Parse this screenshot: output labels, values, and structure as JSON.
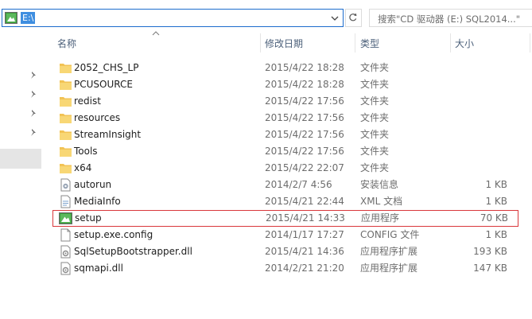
{
  "address_bar": {
    "path": "E:\\"
  },
  "search": {
    "placeholder": "搜索\"CD 驱动器 (E:) SQL2014...\""
  },
  "columns": {
    "name": "名称",
    "date": "修改日期",
    "type": "类型",
    "size": "大小"
  },
  "files": [
    {
      "name": "2052_CHS_LP",
      "date": "2015/4/22 18:28",
      "type": "文件夹",
      "size": "",
      "icon": "folder-icon"
    },
    {
      "name": "PCUSOURCE",
      "date": "2015/4/22 18:28",
      "type": "文件夹",
      "size": "",
      "icon": "folder-icon"
    },
    {
      "name": "redist",
      "date": "2015/4/22 17:56",
      "type": "文件夹",
      "size": "",
      "icon": "folder-icon"
    },
    {
      "name": "resources",
      "date": "2015/4/22 17:56",
      "type": "文件夹",
      "size": "",
      "icon": "folder-icon"
    },
    {
      "name": "StreamInsight",
      "date": "2015/4/22 17:56",
      "type": "文件夹",
      "size": "",
      "icon": "folder-icon"
    },
    {
      "name": "Tools",
      "date": "2015/4/22 17:56",
      "type": "文件夹",
      "size": "",
      "icon": "folder-icon"
    },
    {
      "name": "x64",
      "date": "2015/4/22 22:07",
      "type": "文件夹",
      "size": "",
      "icon": "folder-icon"
    },
    {
      "name": "autorun",
      "date": "2014/2/7 4:56",
      "type": "安装信息",
      "size": "1 KB",
      "icon": "setup-info-icon"
    },
    {
      "name": "MediaInfo",
      "date": "2015/4/21 22:44",
      "type": "XML 文档",
      "size": "1 KB",
      "icon": "xml-document-icon"
    },
    {
      "name": "setup",
      "date": "2015/4/21 14:33",
      "type": "应用程序",
      "size": "70 KB",
      "icon": "application-icon"
    },
    {
      "name": "setup.exe.config",
      "date": "2014/1/17 17:27",
      "type": "CONFIG 文件",
      "size": "1 KB",
      "icon": "file-icon"
    },
    {
      "name": "SqlSetupBootstrapper.dll",
      "date": "2015/4/21 14:36",
      "type": "应用程序扩展",
      "size": "193 KB",
      "icon": "dll-icon"
    },
    {
      "name": "sqmapi.dll",
      "date": "2014/2/21 21:20",
      "type": "应用程序扩展",
      "size": "147 KB",
      "icon": "dll-icon"
    }
  ],
  "colors": {
    "accent": "#1d6ccd",
    "highlight_border": "#d9373b",
    "header_text": "#4c607a",
    "folder": "#f2c355"
  }
}
